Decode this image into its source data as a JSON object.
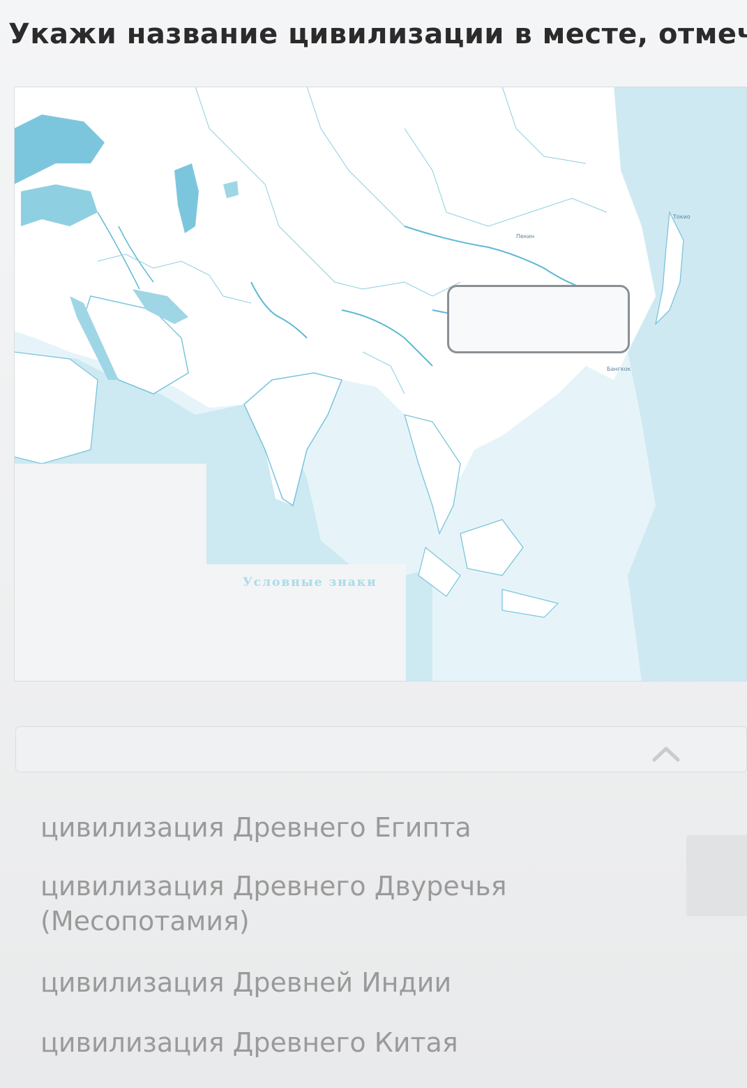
{
  "question": {
    "text": "Укажи название цивилизации в месте, отмеченн"
  },
  "map": {
    "legend_title": "Условные знаки",
    "city_labels": [
      "Пекин",
      "Токио",
      "Бангкок"
    ]
  },
  "dropdown": {
    "selected": "",
    "options": [
      "цивилизация Древнего Египта",
      "цивилизация Древнего Двуречья (Месопотамия)",
      "цивилизация Древней Индии",
      "цивилизация Древнего Китая"
    ]
  },
  "colors": {
    "water": "#7cc6dd",
    "land": "#ffffff",
    "answer_box_border": "#8a8f94",
    "option_text": "#9a9a9a",
    "question_text": "#2b2b2b"
  }
}
